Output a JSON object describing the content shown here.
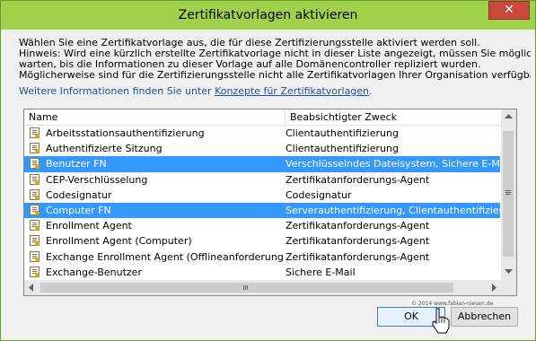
{
  "window": {
    "title": "Zertifikatvorlagen aktivieren",
    "close_glyph": "✕"
  },
  "description_lines": [
    "Wählen Sie eine Zertifikatvorlage aus, die für diese Zertifizierungsstelle aktiviert werden soll.",
    "Hinweis: Wird eine kürzlich erstellte Zertifikatvorlage nicht in dieser Liste angezeigt, müssen Sie möglicherweise",
    "warten, bis die Informationen zu dieser Vorlage auf alle Domänencontroller repliziert wurden.",
    "Möglicherweise sind für die Zertifizierungsstelle nicht alle Zertifikatvorlagen Ihrer Organisation verfügbar."
  ],
  "info": {
    "prefix": "Weitere Informationen finden Sie unter ",
    "link": "Konzepte für Zertifikatvorlagen",
    "suffix": "."
  },
  "table": {
    "columns": [
      "Name",
      "Beabsichtigter Zweck"
    ],
    "rows": [
      {
        "name": "Arbeitsstationsauthentifizierung",
        "purpose": "Clientauthentifizierung",
        "selected": false
      },
      {
        "name": "Authentifizierte Sitzung",
        "purpose": "Clientauthentifizierung",
        "selected": false
      },
      {
        "name": "Benutzer FN",
        "purpose": "Verschlüsselndes Dateisystem, Sichere E-Mail, C",
        "selected": true
      },
      {
        "name": "CEP-Verschlüsselung",
        "purpose": "Zertifikatanforderungs-Agent",
        "selected": false
      },
      {
        "name": "Codesignatur",
        "purpose": "Codesignatur",
        "selected": false
      },
      {
        "name": "Computer FN",
        "purpose": "Serverauthentifizierung, Clientauthentifizierung",
        "selected": true
      },
      {
        "name": "Enrollment Agent",
        "purpose": "Zertifikatanforderungs-Agent",
        "selected": false
      },
      {
        "name": "Enrollment Agent (Computer)",
        "purpose": "Zertifikatanforderungs-Agent",
        "selected": false
      },
      {
        "name": "Exchange Enrollment Agent (Offlineanforderung)",
        "purpose": "Zertifikatanforderungs-Agent",
        "selected": false
      },
      {
        "name": "Exchange-Benutzer",
        "purpose": "Sichere E-Mail",
        "selected": false
      }
    ]
  },
  "watermark": "© 2014 www.fabian-niesen.de",
  "buttons": {
    "ok": "OK",
    "cancel": "Abbrechen"
  },
  "colors": {
    "titlebar": "#9fd24a",
    "close": "#c74a3c",
    "selection": "#3399ff",
    "link": "#1f4fa0"
  },
  "icons": {
    "template": "certificate-template-icon",
    "cursor": "mouse-pointer-icon"
  }
}
